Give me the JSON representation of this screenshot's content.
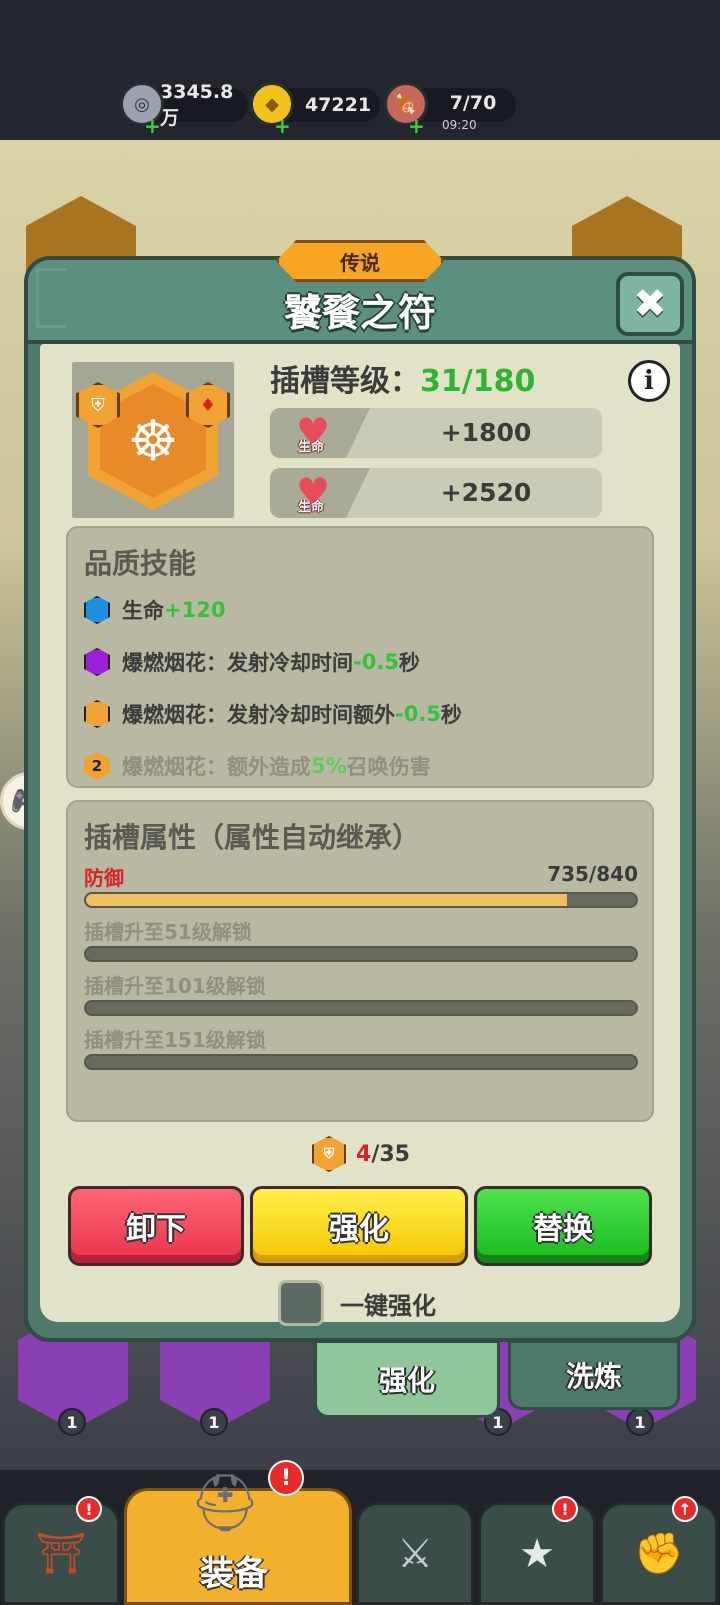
{
  "resources": {
    "silver": "3345.8万",
    "gold": "47221",
    "stamina": "7/70",
    "stamina_timer": "09:20"
  },
  "dialog": {
    "rarity": "传说",
    "title": "饕餮之符",
    "close": "✖",
    "info": "i",
    "slot_level_label": "插槽等级：",
    "slot_level_value": "31/180",
    "stats": [
      {
        "icon_label": "生命",
        "value": "+1800"
      },
      {
        "icon_label": "生命",
        "value": "+2520"
      }
    ]
  },
  "quality_skills": {
    "title": "品质技能",
    "items": [
      {
        "gem_color": "#1b8fe0",
        "prefix": "生命",
        "highlight": "+120",
        "suffix": ""
      },
      {
        "gem_color": "#9a1fd6",
        "prefix": "爆燃烟花：发射冷却时间",
        "highlight": "-0.5",
        "suffix": "秒"
      },
      {
        "gem_color": "#f0a233",
        "prefix": "爆燃烟花：发射冷却时间额外",
        "highlight": "-0.5",
        "suffix": "秒"
      },
      {
        "gem_label": "2",
        "prefix": "爆燃烟花：额外造成",
        "highlight": "5%",
        "suffix": "召唤伤害"
      }
    ]
  },
  "slot_attributes": {
    "title": "插槽属性（属性自动继承）",
    "current_name": "防御",
    "current_value": "735/840",
    "progress": 0.875,
    "locked": [
      "插槽升至51级解锁",
      "插槽升至101级解锁",
      "插槽升至151级解锁"
    ]
  },
  "cost": {
    "have": "4",
    "need": "/35"
  },
  "buttons": {
    "unequip": "卸下",
    "enhance": "强化",
    "replace": "替换"
  },
  "auto_enhance_label": "一键强化",
  "tabs": {
    "enhance": "强化",
    "refine": "洗炼"
  },
  "nav": {
    "equipment": "装备",
    "alert": "!"
  },
  "hex_levels": [
    "1",
    "1",
    "1",
    "1"
  ]
}
